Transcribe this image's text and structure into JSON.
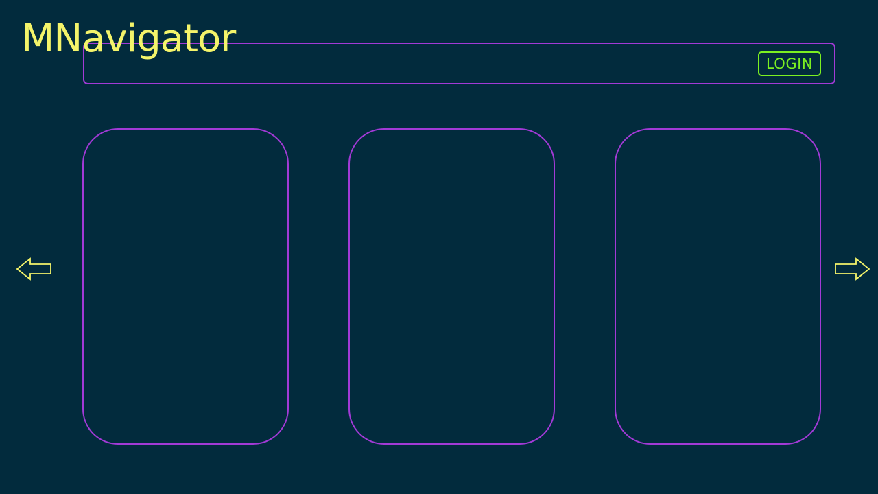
{
  "app": {
    "title": "MNavigator"
  },
  "header": {
    "login_label": "LOGIN"
  },
  "carousel": {
    "cards": [
      {
        "id": "card-1"
      },
      {
        "id": "card-2"
      },
      {
        "id": "card-3"
      }
    ],
    "prev_icon": "left-arrow-icon",
    "next_icon": "right-arrow-icon"
  },
  "colors": {
    "background": "#022b3d",
    "title": "#f4f46a",
    "border_accent": "#a23ad6",
    "login": "#7cf021",
    "arrow": "#f4f46a"
  }
}
